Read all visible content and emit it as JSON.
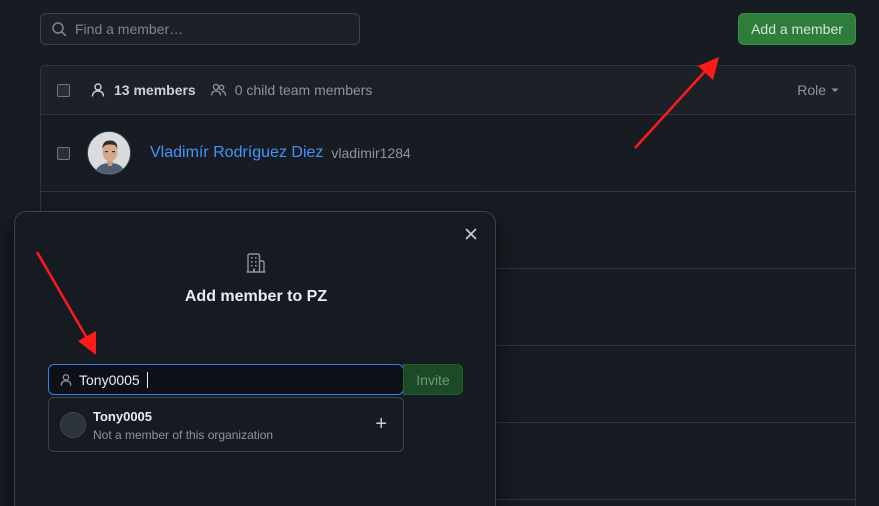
{
  "search": {
    "placeholder": "Find a member…"
  },
  "toolbar": {
    "add_member_label": "Add a member"
  },
  "members_header": {
    "count_label": "13 members",
    "child_label": "0 child team members",
    "role_label": "Role"
  },
  "members": [
    {
      "name": "Vladimír Rodríguez Diez",
      "login": "vladimir1284"
    }
  ],
  "modal": {
    "title": "Add member to PZ",
    "input_value": "Tony0005",
    "invite_label": "Invite",
    "suggestion": {
      "name": "Tony0005",
      "subtitle": "Not a member of this organization"
    }
  },
  "colors": {
    "accent": "#2f81f7",
    "primary_button": "#2e7d3a",
    "link": "#4493f8",
    "annotation_arrow": "#ff1a1a"
  }
}
